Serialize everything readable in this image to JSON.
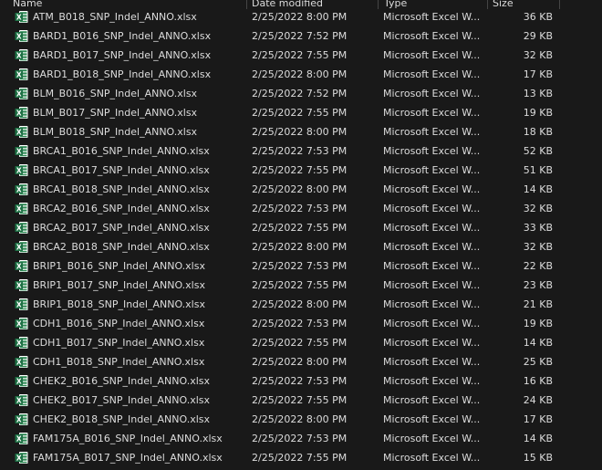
{
  "columns": {
    "name": "Name",
    "date": "Date modified",
    "type": "Type",
    "size": "Size"
  },
  "icon": {
    "name": "excel-file-icon",
    "color": "#1d7044",
    "letter": "X"
  },
  "files": [
    {
      "name": "ATM_B018_SNP_Indel_ANNO.xlsx",
      "date": "2/25/2022 8:00 PM",
      "type": "Microsoft Excel W...",
      "size": "36 KB"
    },
    {
      "name": "BARD1_B016_SNP_Indel_ANNO.xlsx",
      "date": "2/25/2022 7:52 PM",
      "type": "Microsoft Excel W...",
      "size": "29 KB"
    },
    {
      "name": "BARD1_B017_SNP_Indel_ANNO.xlsx",
      "date": "2/25/2022 7:55 PM",
      "type": "Microsoft Excel W...",
      "size": "32 KB"
    },
    {
      "name": "BARD1_B018_SNP_Indel_ANNO.xlsx",
      "date": "2/25/2022 8:00 PM",
      "type": "Microsoft Excel W...",
      "size": "17 KB"
    },
    {
      "name": "BLM_B016_SNP_Indel_ANNO.xlsx",
      "date": "2/25/2022 7:52 PM",
      "type": "Microsoft Excel W...",
      "size": "13 KB"
    },
    {
      "name": "BLM_B017_SNP_Indel_ANNO.xlsx",
      "date": "2/25/2022 7:55 PM",
      "type": "Microsoft Excel W...",
      "size": "19 KB"
    },
    {
      "name": "BLM_B018_SNP_Indel_ANNO.xlsx",
      "date": "2/25/2022 8:00 PM",
      "type": "Microsoft Excel W...",
      "size": "18 KB"
    },
    {
      "name": "BRCA1_B016_SNP_Indel_ANNO.xlsx",
      "date": "2/25/2022 7:53 PM",
      "type": "Microsoft Excel W...",
      "size": "52 KB"
    },
    {
      "name": "BRCA1_B017_SNP_Indel_ANNO.xlsx",
      "date": "2/25/2022 7:55 PM",
      "type": "Microsoft Excel W...",
      "size": "51 KB"
    },
    {
      "name": "BRCA1_B018_SNP_Indel_ANNO.xlsx",
      "date": "2/25/2022 8:00 PM",
      "type": "Microsoft Excel W...",
      "size": "14 KB"
    },
    {
      "name": "BRCA2_B016_SNP_Indel_ANNO.xlsx",
      "date": "2/25/2022 7:53 PM",
      "type": "Microsoft Excel W...",
      "size": "32 KB"
    },
    {
      "name": "BRCA2_B017_SNP_Indel_ANNO.xlsx",
      "date": "2/25/2022 7:55 PM",
      "type": "Microsoft Excel W...",
      "size": "33 KB"
    },
    {
      "name": "BRCA2_B018_SNP_Indel_ANNO.xlsx",
      "date": "2/25/2022 8:00 PM",
      "type": "Microsoft Excel W...",
      "size": "32 KB"
    },
    {
      "name": "BRIP1_B016_SNP_Indel_ANNO.xlsx",
      "date": "2/25/2022 7:53 PM",
      "type": "Microsoft Excel W...",
      "size": "22 KB"
    },
    {
      "name": "BRIP1_B017_SNP_Indel_ANNO.xlsx",
      "date": "2/25/2022 7:55 PM",
      "type": "Microsoft Excel W...",
      "size": "23 KB"
    },
    {
      "name": "BRIP1_B018_SNP_Indel_ANNO.xlsx",
      "date": "2/25/2022 8:00 PM",
      "type": "Microsoft Excel W...",
      "size": "21 KB"
    },
    {
      "name": "CDH1_B016_SNP_Indel_ANNO.xlsx",
      "date": "2/25/2022 7:53 PM",
      "type": "Microsoft Excel W...",
      "size": "19 KB"
    },
    {
      "name": "CDH1_B017_SNP_Indel_ANNO.xlsx",
      "date": "2/25/2022 7:55 PM",
      "type": "Microsoft Excel W...",
      "size": "14 KB"
    },
    {
      "name": "CDH1_B018_SNP_Indel_ANNO.xlsx",
      "date": "2/25/2022 8:00 PM",
      "type": "Microsoft Excel W...",
      "size": "25 KB"
    },
    {
      "name": "CHEK2_B016_SNP_Indel_ANNO.xlsx",
      "date": "2/25/2022 7:53 PM",
      "type": "Microsoft Excel W...",
      "size": "16 KB"
    },
    {
      "name": "CHEK2_B017_SNP_Indel_ANNO.xlsx",
      "date": "2/25/2022 7:55 PM",
      "type": "Microsoft Excel W...",
      "size": "24 KB"
    },
    {
      "name": "CHEK2_B018_SNP_Indel_ANNO.xlsx",
      "date": "2/25/2022 8:00 PM",
      "type": "Microsoft Excel W...",
      "size": "17 KB"
    },
    {
      "name": "FAM175A_B016_SNP_Indel_ANNO.xlsx",
      "date": "2/25/2022 7:53 PM",
      "type": "Microsoft Excel W...",
      "size": "14 KB"
    },
    {
      "name": "FAM175A_B017_SNP_Indel_ANNO.xlsx",
      "date": "2/25/2022 7:55 PM",
      "type": "Microsoft Excel W...",
      "size": "15 KB"
    }
  ]
}
